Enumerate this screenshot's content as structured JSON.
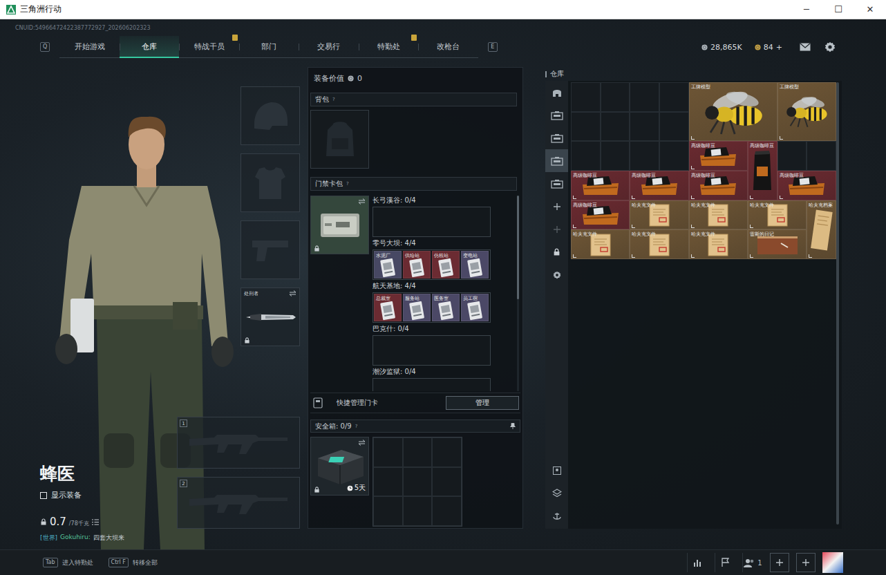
{
  "window": {
    "title": "三角洲行动",
    "controls": [
      "─",
      "☐",
      "✕"
    ]
  },
  "uid": "CNUID:54966472422387772927_202606202323",
  "nav": {
    "leftKey": "Q",
    "rightKey": "E",
    "tabs": [
      {
        "label": "开始游戏",
        "selected": false,
        "alert": false
      },
      {
        "label": "仓库",
        "selected": true,
        "alert": false
      },
      {
        "label": "特战干员",
        "selected": false,
        "alert": true
      },
      {
        "label": "部门",
        "selected": false,
        "alert": false
      },
      {
        "label": "交易行",
        "selected": false,
        "alert": false
      },
      {
        "label": "特勤处",
        "selected": false,
        "alert": true
      },
      {
        "label": "改枪台",
        "selected": false,
        "alert": false
      }
    ]
  },
  "currency": {
    "silver": "28,865K",
    "gold": "84",
    "goldAction": "+"
  },
  "character": {
    "name": "蜂医",
    "showEquipment": {
      "label": "显示装备",
      "checked": false
    },
    "weight": "0.7",
    "capacity": "/78千克",
    "chat": {
      "channel": "[世界]",
      "sender": "Gokuhiru:",
      "message": "四套大坝来"
    }
  },
  "equipmentSlots": [
    {
      "kind": "helmet",
      "label": "",
      "locked": false
    },
    {
      "kind": "armor",
      "label": "",
      "locked": false
    },
    {
      "kind": "pistol",
      "label": "",
      "locked": false
    },
    {
      "kind": "knife",
      "label": "处刑者",
      "locked": true
    }
  ],
  "weaponSlots": [
    {
      "number": "1"
    },
    {
      "number": "2"
    }
  ],
  "loadout": {
    "valueLabel": "装备价值",
    "value": "0",
    "backpack": {
      "title": "背包",
      "help": "?"
    },
    "keycard": {
      "title": "门禁卡包",
      "help": "?",
      "locked": true,
      "maps": [
        {
          "name": "长弓溪谷",
          "count": "0/4",
          "cards": []
        },
        {
          "name": "零号大坝",
          "count": "4/4",
          "cards": [
            {
              "name": "水泥厂",
              "color": "#474863"
            },
            {
              "name": "供给站",
              "color": "#6b2b32"
            },
            {
              "name": "仿核站",
              "color": "#6b2b32"
            },
            {
              "name": "变电站",
              "color": "#4b4866"
            }
          ]
        },
        {
          "name": "航天基地",
          "count": "4/4",
          "cards": [
            {
              "name": "总裁室",
              "color": "#6b2b32"
            },
            {
              "name": "服务站",
              "color": "#4b4866"
            },
            {
              "name": "医务室",
              "color": "#4b4866"
            },
            {
              "name": "员工宿",
              "color": "#4b4866"
            }
          ]
        },
        {
          "name": "巴克什",
          "count": "0/4",
          "cards": []
        },
        {
          "name": "潮汐监狱",
          "count": "0/4",
          "cards": []
        }
      ]
    },
    "quickManage": {
      "label": "快捷管理门卡",
      "button": "管理"
    },
    "safebox": {
      "title": "安全箱:",
      "count": "0/9",
      "help": "?",
      "duration": "5天",
      "locked": true
    }
  },
  "warehouse": {
    "title": "仓库",
    "sideTabs": [
      {
        "kind": "overview",
        "selected": false,
        "disabled": false
      },
      {
        "kind": "case",
        "selected": false,
        "disabled": false
      },
      {
        "kind": "case",
        "selected": false,
        "disabled": false
      },
      {
        "kind": "case",
        "selected": true,
        "disabled": false
      },
      {
        "kind": "case",
        "selected": false,
        "disabled": false
      },
      {
        "kind": "add",
        "selected": false,
        "disabled": false
      },
      {
        "kind": "add",
        "selected": false,
        "disabled": true
      },
      {
        "kind": "lock",
        "selected": false,
        "disabled": false
      },
      {
        "kind": "settings",
        "selected": false,
        "disabled": false
      }
    ],
    "sideTools": [
      {
        "kind": "sort"
      },
      {
        "kind": "layers"
      },
      {
        "kind": "anchor"
      }
    ],
    "items": [
      {
        "kind": "empty"
      },
      {
        "kind": "empty"
      },
      {
        "kind": "empty"
      },
      {
        "kind": "empty"
      },
      {
        "kind": "model-wide",
        "name": "工牌模型",
        "color": "#6d5535"
      },
      {
        "kind": "model",
        "name": "工牌模型",
        "color": "#6d5535"
      },
      {
        "kind": "empty"
      },
      {
        "kind": "empty"
      },
      {
        "kind": "empty"
      },
      {
        "kind": "empty"
      },
      {
        "kind": "empty"
      },
      {
        "kind": "empty"
      },
      {
        "kind": "empty"
      },
      {
        "kind": "empty"
      },
      {
        "kind": "coffee",
        "name": "高级咖啡豆",
        "color": "#6a2a30"
      },
      {
        "kind": "coffee-bag",
        "name": "高级咖啡豆",
        "color": "#6a2a30"
      },
      {
        "kind": "empty"
      },
      {
        "kind": "empty"
      },
      {
        "kind": "coffee",
        "name": "高级咖啡豆",
        "color": "#6a2a30"
      },
      {
        "kind": "coffee",
        "name": "高级咖啡豆",
        "color": "#6a2a30"
      },
      {
        "kind": "coffee",
        "name": "高级咖啡豆",
        "color": "#6a2a30"
      },
      {
        "kind": "coffee",
        "name": "高级咖啡豆",
        "color": "#6a2a30"
      },
      {
        "kind": "coffee",
        "name": "高级咖啡豆",
        "color": "#6a2a30"
      },
      {
        "kind": "document",
        "name": "哈夫克文件",
        "color": "#6d5535"
      },
      {
        "kind": "document",
        "name": "哈夫克文件",
        "color": "#6d5535"
      },
      {
        "kind": "document",
        "name": "哈夫克文件",
        "color": "#6d5535"
      },
      {
        "kind": "file-tall",
        "name": "哈夫克档案",
        "color": "#6d5535"
      },
      {
        "kind": "document",
        "name": "哈夫克文件",
        "color": "#6d5535"
      },
      {
        "kind": "document",
        "name": "哈夫克文件",
        "color": "#6d5535"
      },
      {
        "kind": "document",
        "name": "哈夫克文件",
        "color": "#6d5535"
      },
      {
        "kind": "notebook",
        "name": "雷斯的日记",
        "color": "#6d5535"
      }
    ]
  },
  "bottomBar": {
    "hints": [
      {
        "key": "Tab",
        "label": "进入特勤处"
      },
      {
        "key": "Ctrl F",
        "label": "转移全部"
      }
    ],
    "squad": "1"
  }
}
